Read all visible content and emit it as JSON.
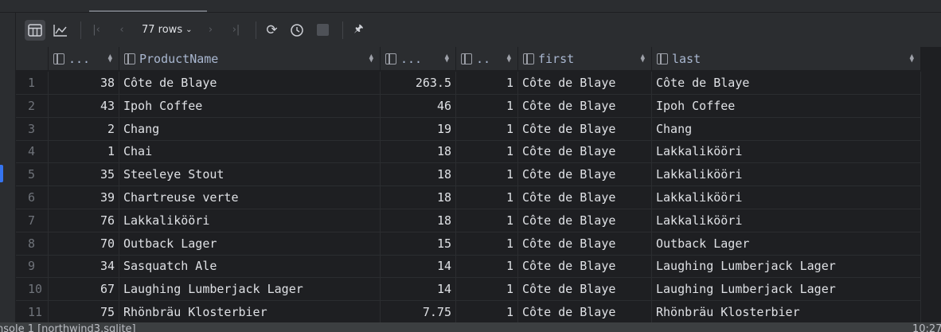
{
  "toolbar": {
    "rows_label": "77 rows"
  },
  "columns": [
    {
      "label": "..."
    },
    {
      "label": "ProductName"
    },
    {
      "label": "..."
    },
    {
      "label": ".."
    },
    {
      "label": "first"
    },
    {
      "label": "last"
    }
  ],
  "rows": [
    {
      "n": "1",
      "c1": "38",
      "c2": "Côte de Blaye",
      "c3": "263.5",
      "c4": "1",
      "first": "Côte de Blaye",
      "last": "Côte de Blaye"
    },
    {
      "n": "2",
      "c1": "43",
      "c2": "Ipoh Coffee",
      "c3": "46",
      "c4": "1",
      "first": "Côte de Blaye",
      "last": "Ipoh Coffee"
    },
    {
      "n": "3",
      "c1": "2",
      "c2": "Chang",
      "c3": "19",
      "c4": "1",
      "first": "Côte de Blaye",
      "last": "Chang"
    },
    {
      "n": "4",
      "c1": "1",
      "c2": "Chai",
      "c3": "18",
      "c4": "1",
      "first": "Côte de Blaye",
      "last": "Lakkalikööri"
    },
    {
      "n": "5",
      "c1": "35",
      "c2": "Steeleye Stout",
      "c3": "18",
      "c4": "1",
      "first": "Côte de Blaye",
      "last": "Lakkalikööri"
    },
    {
      "n": "6",
      "c1": "39",
      "c2": "Chartreuse verte",
      "c3": "18",
      "c4": "1",
      "first": "Côte de Blaye",
      "last": "Lakkalikööri"
    },
    {
      "n": "7",
      "c1": "76",
      "c2": "Lakkalikööri",
      "c3": "18",
      "c4": "1",
      "first": "Côte de Blaye",
      "last": "Lakkalikööri"
    },
    {
      "n": "8",
      "c1": "70",
      "c2": "Outback Lager",
      "c3": "15",
      "c4": "1",
      "first": "Côte de Blaye",
      "last": "Outback Lager"
    },
    {
      "n": "9",
      "c1": "34",
      "c2": "Sasquatch Ale",
      "c3": "14",
      "c4": "1",
      "first": "Côte de Blaye",
      "last": "Laughing Lumberjack Lager"
    },
    {
      "n": "10",
      "c1": "67",
      "c2": "Laughing Lumberjack Lager",
      "c3": "14",
      "c4": "1",
      "first": "Côte de Blaye",
      "last": "Laughing Lumberjack Lager"
    },
    {
      "n": "11",
      "c1": "75",
      "c2": "Rhönbräu Klosterbier",
      "c3": "7.75",
      "c4": "1",
      "first": "Côte de Blaye",
      "last": "Rhönbräu Klosterbier"
    }
  ],
  "status": {
    "left": "nsole 1 [northwind3.sqlite]",
    "right": "10:27"
  }
}
